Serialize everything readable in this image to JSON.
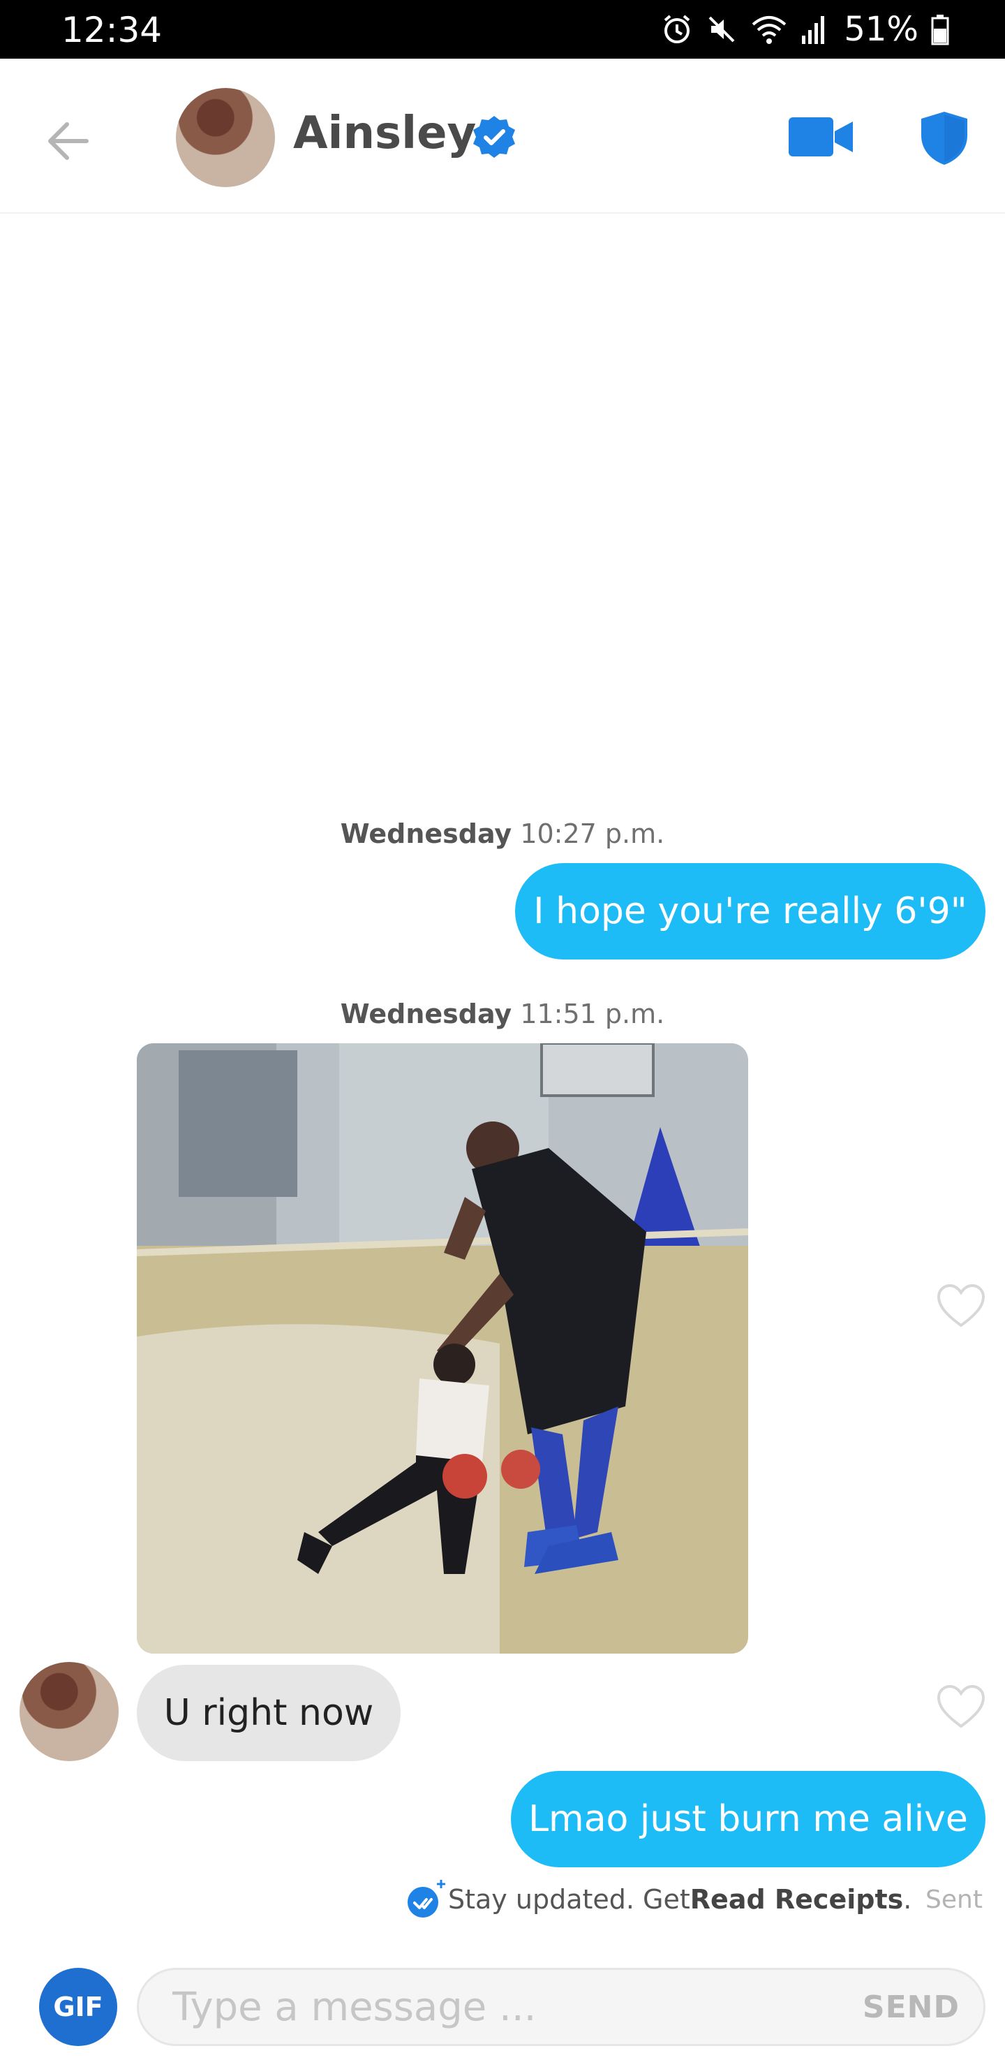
{
  "status_bar": {
    "time": "12:34",
    "battery": "51%"
  },
  "header": {
    "contact_name": "Ainsley"
  },
  "messages": [
    {
      "type": "date",
      "day": "Wednesday",
      "time": "10:27 p.m."
    },
    {
      "type": "text",
      "direction": "outgoing",
      "text": "I hope you're really 6'9\""
    },
    {
      "type": "date",
      "day": "Wednesday",
      "time": "11:51 p.m."
    },
    {
      "type": "gif",
      "direction": "incoming"
    },
    {
      "type": "text",
      "direction": "incoming",
      "text": "U right now"
    },
    {
      "type": "text",
      "direction": "outgoing",
      "text": "Lmao just burn me alive"
    }
  ],
  "receipts": {
    "prefix": "Stay updated. Get ",
    "link": "Read Receipts",
    "suffix": ".",
    "status": "Sent"
  },
  "composer": {
    "gif_label": "GIF",
    "placeholder": "Type a message ...",
    "send_label": "SEND"
  },
  "colors": {
    "outgoing_bubble": "#1ebcf6",
    "incoming_bubble": "#e6e6e6",
    "accent": "#1f83e6",
    "gif_button": "#1f6fd1"
  },
  "icons": [
    "alarm-icon",
    "mute-icon",
    "wifi-icon",
    "signal-icon",
    "battery-icon",
    "back-arrow-icon",
    "verified-badge-icon",
    "video-camera-icon",
    "shield-icon",
    "heart-icon",
    "read-receipt-icon"
  ]
}
